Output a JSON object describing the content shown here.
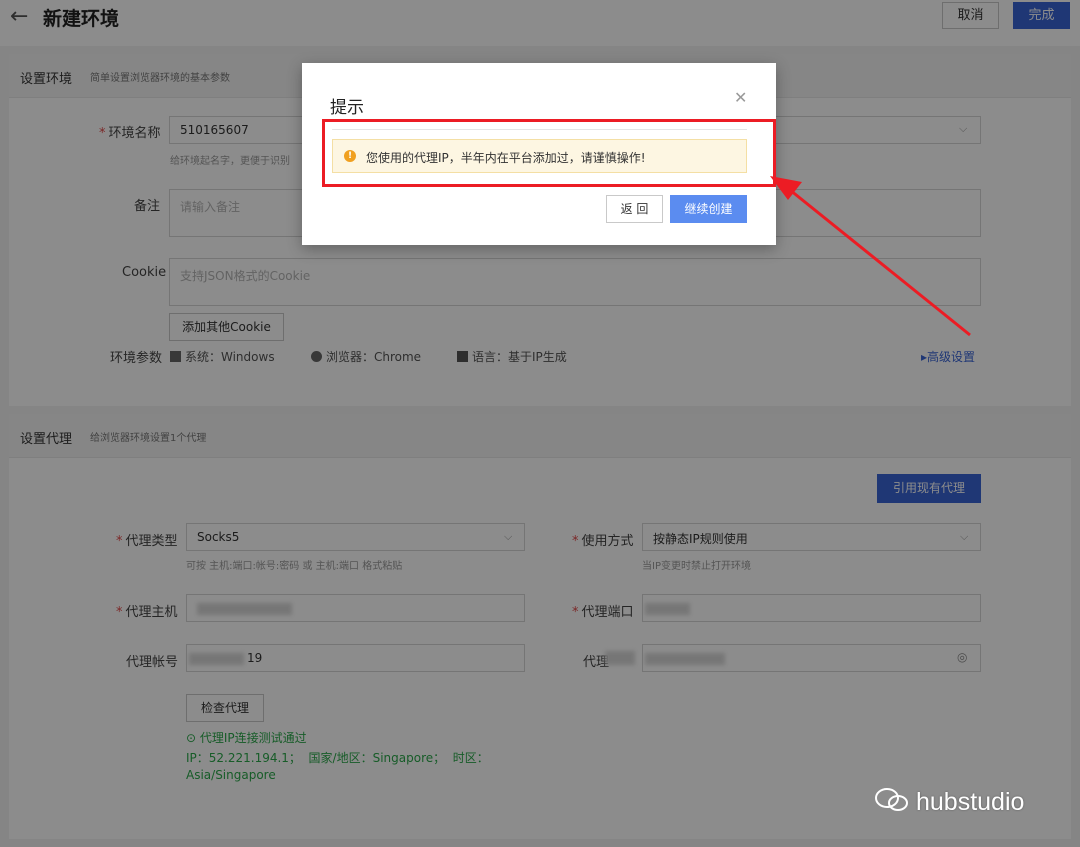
{
  "header": {
    "title": "新建环境",
    "cancel_label": "取消",
    "done_label": "完成"
  },
  "env_section": {
    "title": "设置环境",
    "subtitle": "简单设置浏览器环境的基本参数",
    "name_label": "环境名称",
    "name_value": "510165607",
    "name_hint": "给环境起名字，更便于识别",
    "remark_label": "备注",
    "remark_placeholder": "请输入备注",
    "cookie_label": "Cookie",
    "cookie_placeholder": "支持JSON格式的Cookie",
    "add_cookie_label": "添加其他Cookie",
    "params_label": "环境参数",
    "os": "系统：Windows",
    "browser": "浏览器：Chrome",
    "language": "语言：基于IP生成",
    "advanced_link": "▸高级设置"
  },
  "proxy_section": {
    "title": "设置代理",
    "subtitle": "给浏览器环境设置1个代理",
    "use_existing_label": "引用现有代理",
    "type_label": "代理类型",
    "type_value": "Socks5",
    "type_hint": "可按 主机:端口:帐号:密码 或 主机:端口 格式粘贴",
    "mode_label": "使用方式",
    "mode_value": "按静态IP规则使用",
    "mode_hint": "当IP变更时禁止打开环境",
    "host_label": "代理主机",
    "port_label": "代理端口",
    "account_label": "代理帐号",
    "account_suffix": "19",
    "password_label": "代理",
    "check_label": "检查代理",
    "pass_text": "代理IP连接测试通过",
    "ip_line": "IP：52.221.194.1；  国家/地区：Singapore；  时区：",
    "timezone": "Asia/Singapore"
  },
  "dialog": {
    "title": "提示",
    "message": "您使用的代理IP，半年内在平台添加过，请谨慎操作!",
    "back_label": "返 回",
    "continue_label": "继续创建"
  },
  "watermark": "hubstudio",
  "colors": {
    "primary": "#3964d6",
    "warning": "#f0a020",
    "annotation": "#ec1c24",
    "success": "#2aa84a"
  }
}
